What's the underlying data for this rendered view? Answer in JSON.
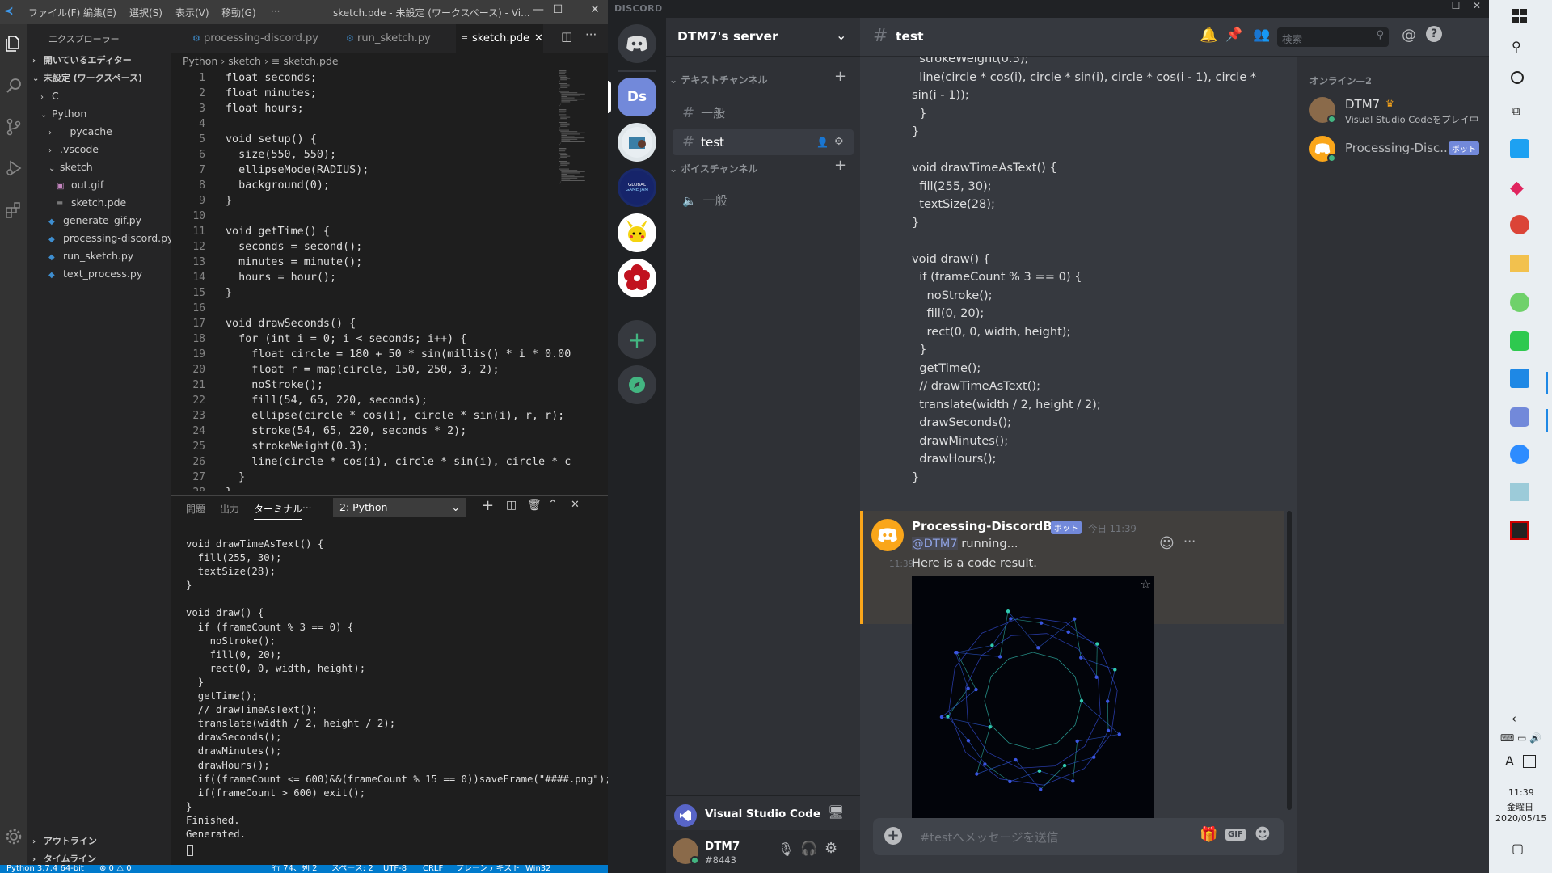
{
  "vscode": {
    "menu": [
      "ファイル(F)",
      "編集(E)",
      "選択(S)",
      "表示(V)",
      "移動(G)",
      "···"
    ],
    "window_title": "sketch.pde - 未設定 (ワークスペース) - Vi...",
    "explorer_title": "エクスプローラー",
    "tree": [
      {
        "label": "開いているエディター",
        "chev": "›",
        "level": 0
      },
      {
        "label": "未設定 (ワークスペース)",
        "chev": "⌄",
        "level": 0
      },
      {
        "label": "C",
        "chev": "›",
        "level": 1
      },
      {
        "label": "Python",
        "chev": "⌄",
        "level": 1
      },
      {
        "label": "__pycache__",
        "chev": "›",
        "level": 2
      },
      {
        "label": ".vscode",
        "chev": "›",
        "level": 2
      },
      {
        "label": "sketch",
        "chev": "⌄",
        "level": 2
      },
      {
        "label": "out.gif",
        "chev": "",
        "level": 3
      },
      {
        "label": "sketch.pde",
        "chev": "",
        "level": 3
      },
      {
        "label": "generate_gif.py",
        "chev": "",
        "level": 2
      },
      {
        "label": "processing-discord.py",
        "chev": "",
        "level": 2
      },
      {
        "label": "run_sketch.py",
        "chev": "",
        "level": 2
      },
      {
        "label": "text_process.py",
        "chev": "",
        "level": 2
      }
    ],
    "outline": "アウトライン",
    "timeline": "タイムライン",
    "tabs": [
      "processing-discord.py",
      "run_sketch.py",
      "sketch.pde"
    ],
    "breadcrumb": "Python › sketch › ≡ sketch.pde",
    "line_numbers": [
      "1",
      "2",
      "3",
      "4",
      "5",
      "6",
      "7",
      "8",
      "9",
      "10",
      "11",
      "12",
      "13",
      "14",
      "15",
      "16",
      "17",
      "18",
      "19",
      "20",
      "21",
      "22",
      "23",
      "24",
      "25",
      "26",
      "27",
      "28"
    ],
    "code": "float seconds;\nfloat minutes;\nfloat hours;\n\nvoid setup() {\n  size(550, 550);\n  ellipseMode(RADIUS);\n  background(0);\n}\n\nvoid getTime() {\n  seconds = second();\n  minutes = minute();\n  hours = hour();\n}\n\nvoid drawSeconds() {\n  for (int i = 0; i < seconds; i++) {\n    float circle = 180 + 50 * sin(millis() * i * 0.00\n    float r = map(circle, 150, 250, 3, 2);\n    noStroke();\n    fill(54, 65, 220, seconds);\n    ellipse(circle * cos(i), circle * sin(i), r, r);\n    stroke(54, 65, 220, seconds * 2);\n    strokeWeight(0.3);\n    line(circle * cos(i), circle * sin(i), circle * c\n  }\n}",
    "panel_tabs": [
      "問題",
      "出力",
      "ターミナル",
      "···"
    ],
    "terminal_select": "2: Python",
    "terminal": "void drawTimeAsText() {\n  fill(255, 30);\n  textSize(28);\n}\n\nvoid draw() {\n  if (frameCount % 3 == 0) {\n    noStroke();\n    fill(0, 20);\n    rect(0, 0, width, height);\n  }\n  getTime();\n  // drawTimeAsText();\n  translate(width / 2, height / 2);\n  drawSeconds();\n  drawMinutes();\n  drawHours();\n  if((frameCount <= 600)&&(frameCount % 15 == 0))saveFrame(\"####.png\");\n  if(frameCount > 600) exit();\n}\nFinished.\nGenerated.",
    "status": {
      "python": "Python 3.7.4 64-bit",
      "problems": "⊗ 0 ⚠ 0",
      "position": "行 74、列 2",
      "spaces": "スペース: 2",
      "encoding": "UTF-8",
      "eol": "CRLF",
      "language": "プレーンテキスト",
      "platform": "Win32"
    }
  },
  "discord": {
    "brand": "DISCORD",
    "guild_ds": "Ds",
    "server_name": "DTM7's server",
    "text_category": "テキストチャンネル",
    "voice_category": "ボイスチャンネル",
    "text_channels": [
      "一般",
      "test"
    ],
    "voice_channels": [
      "一般"
    ],
    "channel_header": "test",
    "search_placeholder": "検索",
    "code_lines": [
      "  strokeWeight(0.5);",
      "  line(circle * cos(i), circle * sin(i), circle * cos(i - 1), circle *",
      "sin(i - 1));",
      "  }",
      "}",
      "",
      "void drawTimeAsText() {",
      "  fill(255, 30);",
      "  textSize(28);",
      "}",
      "",
      "void draw() {",
      "  if (frameCount % 3 == 0) {",
      "    noStroke();",
      "    fill(0, 20);",
      "    rect(0, 0, width, height);",
      "  }",
      "  getTime();",
      "  // drawTimeAsText();",
      "  translate(width / 2, height / 2);",
      "  drawSeconds();",
      "  drawMinutes();",
      "  drawHours();",
      "}"
    ],
    "bot_name": "Processing-DiscordBot",
    "bot_badge": "ボット",
    "bot_time": "今日 11:39",
    "mention": "@DTM7",
    "running": " running...",
    "followup_time": "11:39",
    "followup_text": "Here is a code result.",
    "message_placeholder": "#testへメッセージを送信",
    "gif_label": "GIF",
    "activity": "Visual Studio Code",
    "user_name": "DTM7",
    "user_tag": "#8443",
    "members_online": "オンライン—2",
    "member1_name": "DTM7",
    "member1_status": "Visual Studio Codeをプレイ中",
    "member2_name": "Processing-Disc...",
    "member2_badge": "ボット",
    "accent": "#7289da"
  },
  "taskbar": {
    "time": "11:39",
    "weekday": "金曜日",
    "date": "2020/05/15",
    "ime": "A"
  }
}
